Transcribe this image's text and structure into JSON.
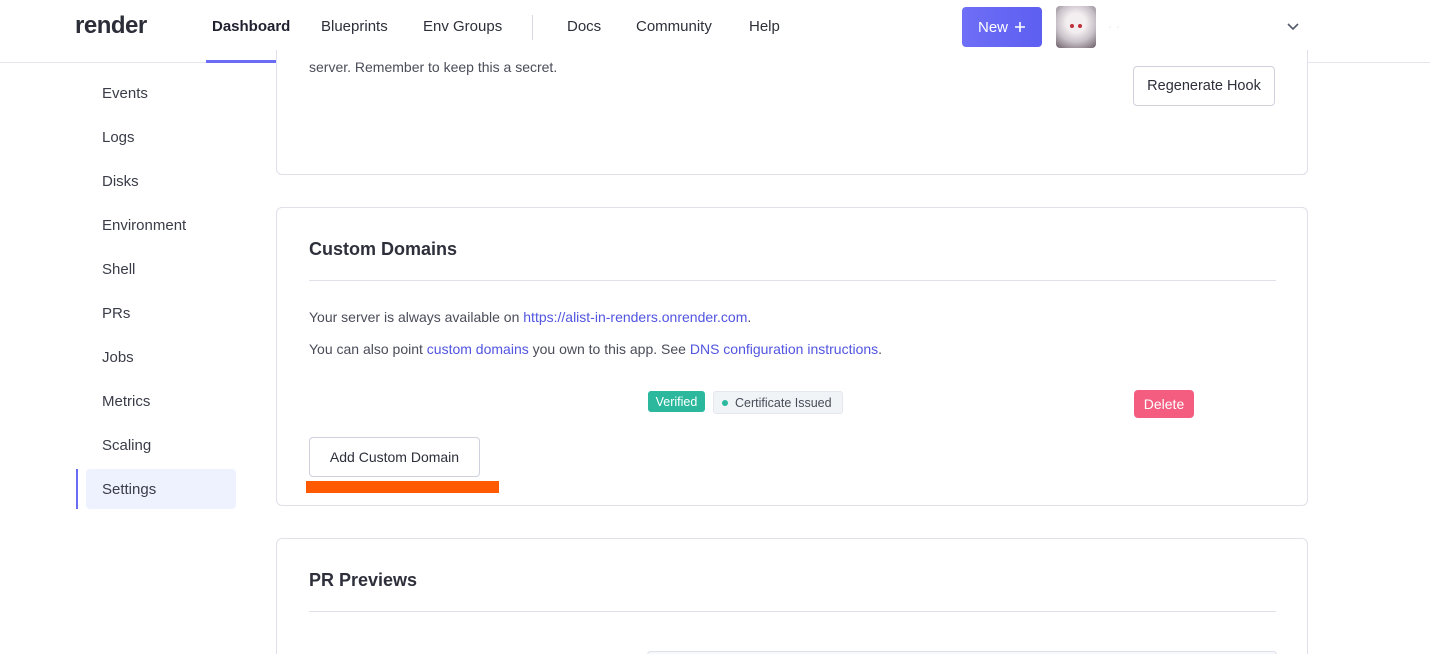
{
  "header": {
    "logo": "render",
    "nav": [
      "Dashboard",
      "Blueprints",
      "Env Groups"
    ],
    "nav2": [
      "Docs",
      "Community",
      "Help"
    ],
    "new_label": "New",
    "new_icon": "plus-icon",
    "account_name": "·        ·"
  },
  "sidebar": {
    "items": [
      "Events",
      "Logs",
      "Disks",
      "Environment",
      "Shell",
      "PRs",
      "Jobs",
      "Metrics",
      "Scaling",
      "Settings"
    ],
    "active": "Settings"
  },
  "deploy_hook": {
    "description_tail": "server. Remember to keep this a secret.",
    "regenerate_label": "Regenerate Hook"
  },
  "custom_domains": {
    "title": "Custom Domains",
    "line1_prefix": "Your server is always available on ",
    "line1_link": "https://alist-in-renders.onrender.com",
    "line1_suffix": ".",
    "line2_prefix": "You can also point ",
    "line2_link1": "custom domains",
    "line2_mid": " you own to this app. See ",
    "line2_link2": "DNS configuration instructions",
    "line2_suffix": ".",
    "domain_row": {
      "verified_label": "Verified",
      "certificate_label": "Certificate Issued",
      "delete_label": "Delete"
    },
    "add_label": "Add Custom Domain"
  },
  "pr_previews": {
    "title": "PR Previews"
  },
  "colors": {
    "accent": "#6b6cf5",
    "link": "#5155e0",
    "verified": "#2bb89d",
    "delete": "#f45c80",
    "annotation": "#ff5a00"
  }
}
